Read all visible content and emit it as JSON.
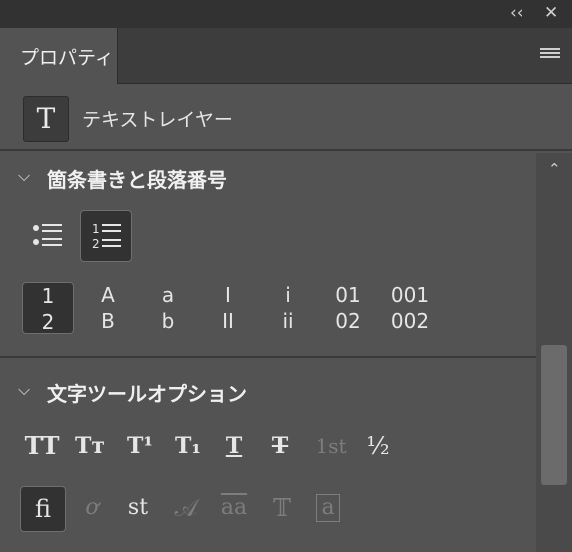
{
  "window": {
    "collapse_glyph": "‹‹",
    "close_glyph": "✕"
  },
  "tab": {
    "label": "プロパティ"
  },
  "layer": {
    "icon_glyph": "T",
    "label": "テキストレイヤー"
  },
  "sections": {
    "list": {
      "title": "箇条書きと段落番号",
      "chevron": "⌵",
      "numbering_styles": [
        {
          "top": "1",
          "bottom": "2",
          "selected": true
        },
        {
          "top": "A",
          "bottom": "B",
          "selected": false
        },
        {
          "top": "a",
          "bottom": "b",
          "selected": false
        },
        {
          "top": "I",
          "bottom": "II",
          "selected": false
        },
        {
          "top": "i",
          "bottom": "ii",
          "selected": false
        },
        {
          "top": "01",
          "bottom": "02",
          "selected": false
        },
        {
          "top": "001",
          "bottom": "002",
          "selected": false
        }
      ]
    },
    "type_options": {
      "title": "文字ツールオプション",
      "chevron": "⌵",
      "row1": [
        {
          "glyph": "TT",
          "icon": "all-caps-icon"
        },
        {
          "glyph": "Tт",
          "icon": "small-caps-icon"
        },
        {
          "glyph": "T¹",
          "icon": "superscript-icon"
        },
        {
          "glyph": "T₁",
          "icon": "subscript-icon"
        },
        {
          "glyph": "T",
          "icon": "underline-icon"
        },
        {
          "glyph": "T",
          "icon": "strikethrough-icon"
        },
        {
          "glyph": "1st",
          "icon": "ordinals-icon"
        },
        {
          "glyph": "½",
          "icon": "fractions-icon"
        }
      ],
      "row2": [
        {
          "glyph": "fi",
          "icon": "standard-ligatures-icon"
        },
        {
          "glyph": "ơ",
          "icon": "contextual-alternates-icon"
        },
        {
          "glyph": "st",
          "icon": "discretionary-ligatures-icon"
        },
        {
          "glyph": "𝒜",
          "icon": "swash-icon"
        },
        {
          "glyph": "aa",
          "icon": "stylistic-alternates-icon"
        },
        {
          "glyph": "𝕋",
          "icon": "titling-alternates-icon"
        },
        {
          "glyph": "a",
          "icon": "stylistic-sets-icon"
        }
      ]
    }
  },
  "scroll": {
    "up_glyph": "⌃"
  }
}
